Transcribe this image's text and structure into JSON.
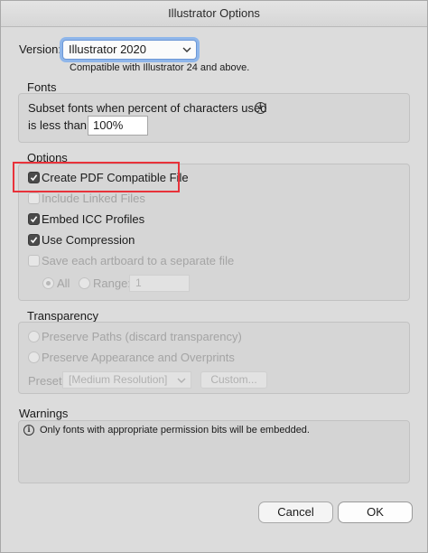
{
  "window": {
    "title": "Illustrator Options"
  },
  "version": {
    "label": "Version:",
    "selected": "Illustrator 2020",
    "note": "Compatible with Illustrator 24 and above."
  },
  "fonts": {
    "legend": "Fonts",
    "subset_label_line1": "Subset fonts when percent of characters used",
    "subset_label_line2": "is less than:",
    "percent_value": "100%"
  },
  "options": {
    "legend": "Options",
    "create_pdf": {
      "label": "Create PDF Compatible File",
      "checked": true
    },
    "include_linked": {
      "label": "Include Linked Files",
      "checked": false,
      "enabled": false
    },
    "embed_icc": {
      "label": "Embed ICC Profiles",
      "checked": true
    },
    "use_compression": {
      "label": "Use Compression",
      "checked": true
    },
    "save_artboards": {
      "label": "Save each artboard to a separate file",
      "checked": false,
      "enabled": false
    },
    "all_label": "All",
    "range_label": "Range:",
    "range_value": "1"
  },
  "transparency": {
    "legend": "Transparency",
    "preserve_paths": "Preserve Paths (discard transparency)",
    "preserve_appearance": "Preserve Appearance and Overprints",
    "preset_label": "Preset:",
    "preset_value": "[Medium Resolution]",
    "custom_button": "Custom..."
  },
  "warnings": {
    "legend": "Warnings",
    "message": "Only fonts with appropriate permission bits will be embedded."
  },
  "buttons": {
    "cancel": "Cancel",
    "ok": "OK"
  },
  "colors": {
    "highlight": "#e8323a",
    "focus_ring": "#8fb6ea"
  }
}
